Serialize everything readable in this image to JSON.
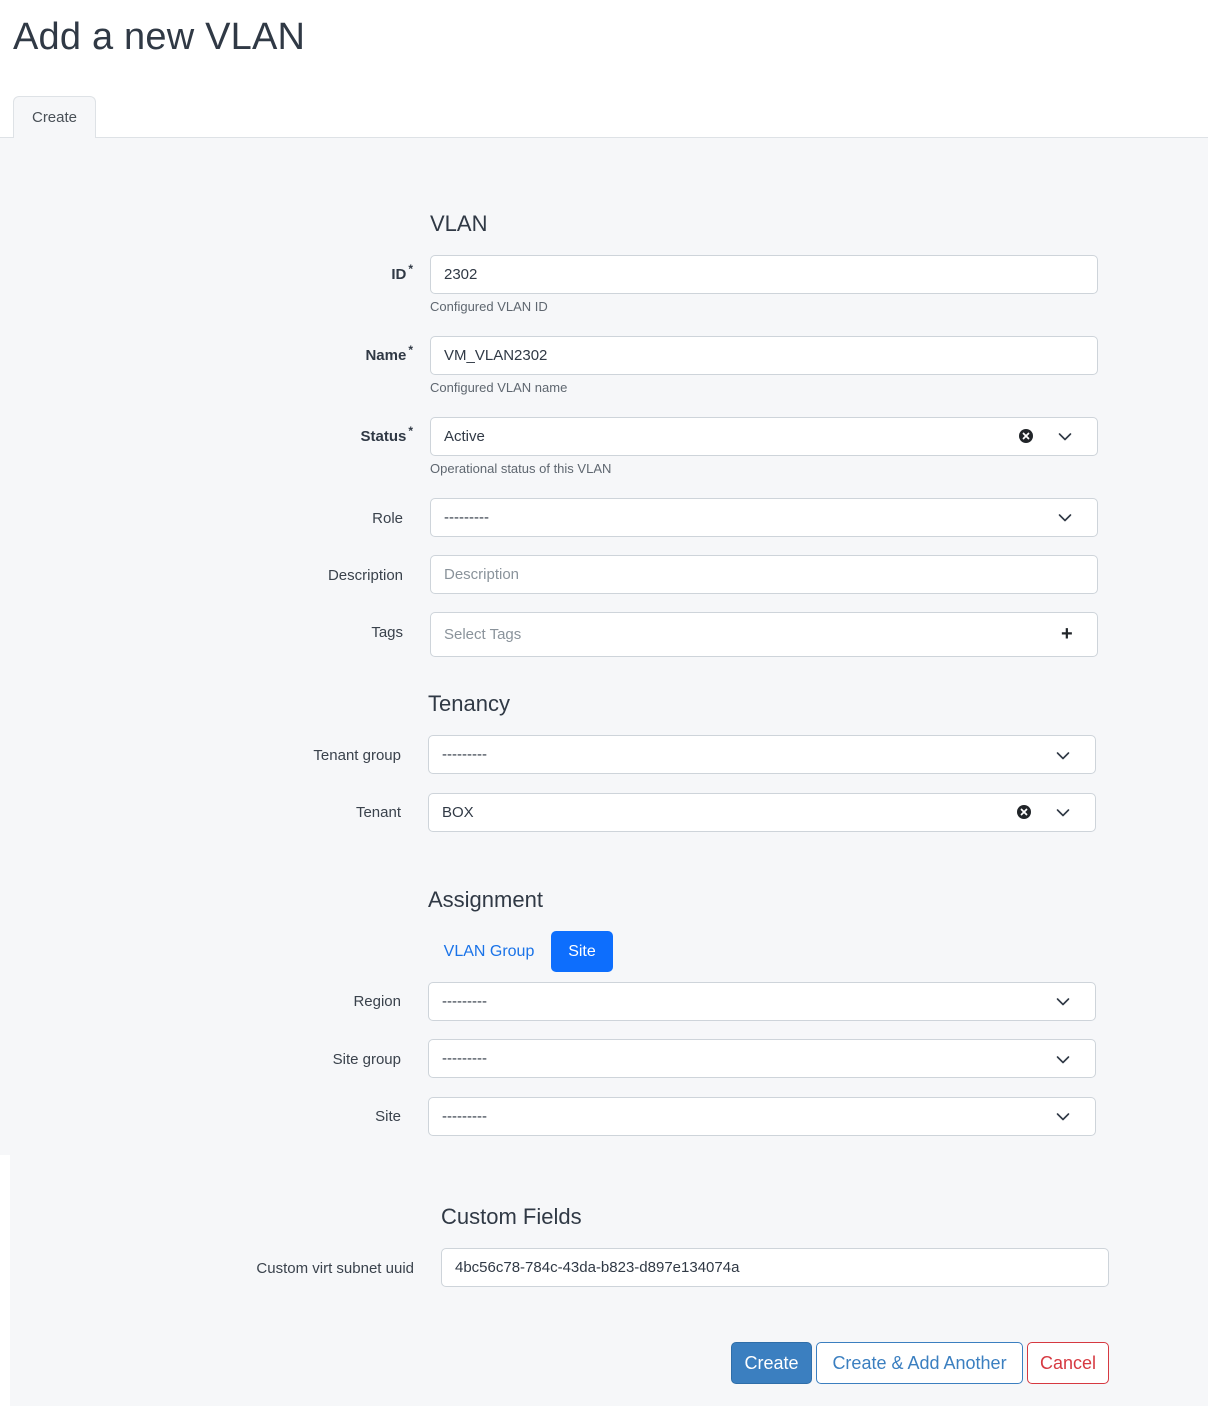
{
  "page": {
    "title": "Add a new VLAN"
  },
  "tabs": [
    {
      "label": "Create"
    }
  ],
  "vlan_section": {
    "title": "VLAN",
    "id": {
      "label": "ID",
      "required_mark": "*",
      "value": "2302",
      "help": "Configured VLAN ID"
    },
    "name": {
      "label": "Name",
      "required_mark": "*",
      "value": "VM_VLAN2302",
      "help": "Configured VLAN name"
    },
    "status": {
      "label": "Status",
      "required_mark": "*",
      "value": "Active",
      "help": "Operational status of this VLAN"
    },
    "role": {
      "label": "Role",
      "value": "---------"
    },
    "description": {
      "label": "Description",
      "placeholder": "Description",
      "value": ""
    },
    "tags": {
      "label": "Tags",
      "placeholder": "Select Tags"
    }
  },
  "tenancy_section": {
    "title": "Tenancy",
    "tenant_group": {
      "label": "Tenant group",
      "value": "---------"
    },
    "tenant": {
      "label": "Tenant",
      "value": "BOX"
    }
  },
  "assignment_section": {
    "title": "Assignment",
    "pills": [
      {
        "label": "VLAN Group",
        "active": false
      },
      {
        "label": "Site",
        "active": true
      }
    ],
    "region": {
      "label": "Region",
      "value": "---------"
    },
    "site_group": {
      "label": "Site group",
      "value": "---------"
    },
    "site": {
      "label": "Site",
      "value": "---------"
    }
  },
  "custom_fields_section": {
    "title": "Custom Fields",
    "virt_subnet_uuid": {
      "label": "Custom virt subnet uuid",
      "value": "4bc56c78-784c-43da-b823-d897e134074a"
    }
  },
  "actions": {
    "create": "Create",
    "create_add_another": "Create & Add Another",
    "cancel": "Cancel"
  },
  "icons": {
    "chevron": "chevron-down-icon",
    "clear": "clear-selection-icon",
    "plus": "plus-icon"
  },
  "colors": {
    "primary": "#3b7fc0",
    "active_pill": "#0d6efd",
    "link": "#1a73e8",
    "danger": "#d63941",
    "panel_bg": "#f6f7f9"
  }
}
